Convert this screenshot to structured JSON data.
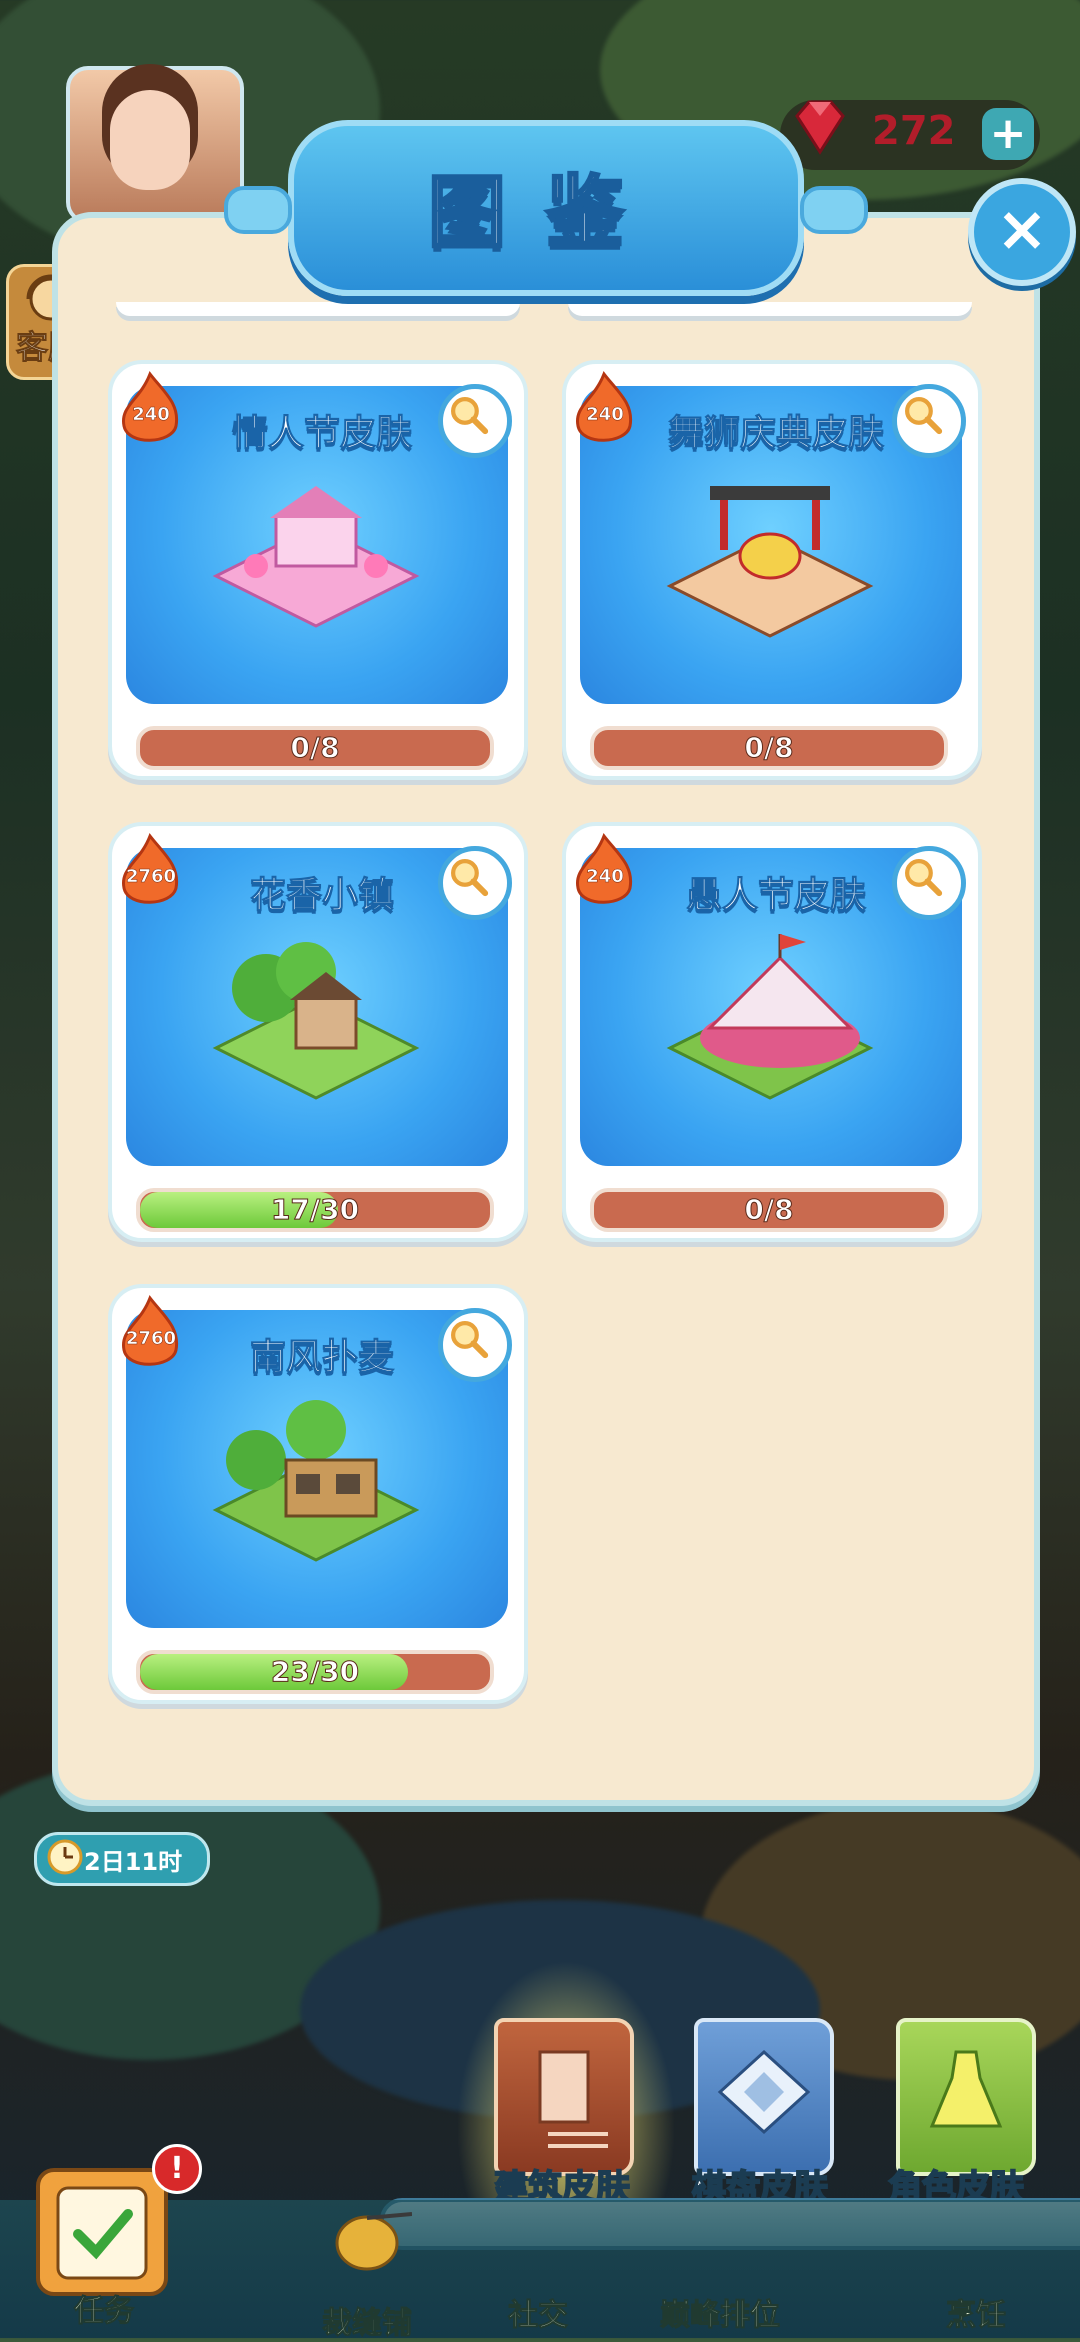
{
  "hud": {
    "gem_count": "272",
    "gem_plus": "+",
    "kefu_label": "客服"
  },
  "dialog": {
    "title": "图鉴",
    "close_symbol": "×"
  },
  "cards": [
    {
      "title": "情人节皮肤",
      "points": "240",
      "progress_text": "0/8",
      "progress": 0.0
    },
    {
      "title": "舞狮庆典皮肤",
      "points": "240",
      "progress_text": "0/8",
      "progress": 0.0
    },
    {
      "title": "花香小镇",
      "points": "2760",
      "progress_text": "17/30",
      "progress": 0.567
    },
    {
      "title": "愚人节皮肤",
      "points": "240",
      "progress_text": "0/8",
      "progress": 0.0
    },
    {
      "title": "南风扑麦",
      "points": "2760",
      "progress_text": "23/30",
      "progress": 0.767
    }
  ],
  "timer": {
    "text": "2日11时"
  },
  "categories": {
    "building": "建筑皮肤",
    "board": "棋盘皮肤",
    "character": "角色皮肤"
  },
  "nav": {
    "task": "任务",
    "task_badge": "!",
    "tailor": "裁缝铺",
    "social": "社交",
    "rank": "巅峰排位",
    "cook": "烹饪"
  },
  "colors": {
    "panel_bg": "#f7e9d0",
    "card_blue": "#3aa4f2",
    "progress_empty": "#c96a4f",
    "progress_fill": "#6dc93a",
    "gem_red": "#b21d2a"
  }
}
